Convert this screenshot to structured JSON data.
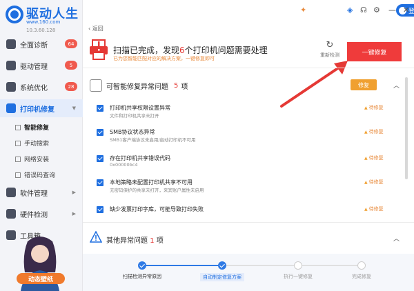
{
  "app": {
    "brand": "驱动人生",
    "url": "www.160.com",
    "version": "10.3.60.128"
  },
  "topbar": {
    "login_label": "登录",
    "back_label": "返回"
  },
  "sidebar": {
    "items": [
      {
        "label": "全面诊断",
        "badge": "64"
      },
      {
        "label": "驱动管理",
        "badge": "5"
      },
      {
        "label": "系统优化",
        "badge": "28"
      },
      {
        "label": "打印机修复",
        "badge": ""
      },
      {
        "label": "软件管理",
        "badge": ""
      },
      {
        "label": "硬件检测",
        "badge": ""
      },
      {
        "label": "工具箱",
        "badge": ""
      }
    ],
    "subitems": [
      "智能修复",
      "手动搜索",
      "网络安装",
      "错误码查询"
    ],
    "promo_text": "动态壁纸"
  },
  "summary": {
    "headline_pre": "扫描已完成，发现",
    "headline_count": "6",
    "headline_post": "个打印机问题需要处理",
    "subline": "已为您智能匹配对应的解决方案，一键修复即可",
    "refresh_label": "重新检测",
    "primary_button": "一键修复"
  },
  "section1": {
    "title": "可智能修复异常问题",
    "count": "5",
    "unit": "项",
    "fix_button": "修复",
    "items": [
      {
        "title": "打印机共享权限设置异常",
        "desc": "文件和打印机共享未打开",
        "status": "待修复"
      },
      {
        "title": "SMB协议状态异常",
        "desc": "SMB1客户端协议未启用/启动打印机不可用",
        "status": "待修复"
      },
      {
        "title": "存在打印机共享错误代码",
        "desc": "0x00000bc4",
        "status": "待修复"
      },
      {
        "title": "本地策略未配置打印机共享不可用",
        "desc": "无密码保护的共享未打开，来宾账户属性未启用",
        "status": "待修复"
      },
      {
        "title": "缺少发票打印字库，可能导致打印失败",
        "desc": "",
        "status": "待修复"
      }
    ]
  },
  "section2": {
    "title": "其他异常问题",
    "count": "1",
    "unit": "项"
  },
  "steps": [
    {
      "label": "扫描检测异常原因",
      "state": "done"
    },
    {
      "label": "自动制定修复方案",
      "state": "current"
    },
    {
      "label": "执行一键修复",
      "state": "todo"
    },
    {
      "label": "完成修复",
      "state": "todo"
    }
  ],
  "colors": {
    "brand_blue": "#1f6fe0",
    "danger_red": "#ef3b3b",
    "warn_orange": "#f0a030"
  }
}
